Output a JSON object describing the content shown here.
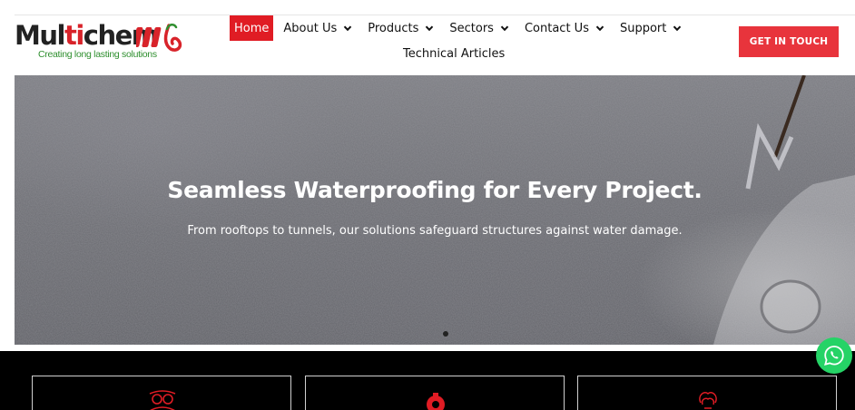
{
  "brand": {
    "name_part1": "Mul",
    "name_highlight": "ti",
    "name_part2": "chem",
    "tagline": "Creating long lasting solutions"
  },
  "nav": {
    "items": [
      {
        "label": "Home",
        "active": true,
        "dropdown": false
      },
      {
        "label": "About Us",
        "active": false,
        "dropdown": true
      },
      {
        "label": "Products",
        "active": false,
        "dropdown": true
      },
      {
        "label": "Sectors",
        "active": false,
        "dropdown": true
      },
      {
        "label": "Contact Us",
        "active": false,
        "dropdown": true
      },
      {
        "label": "Support",
        "active": false,
        "dropdown": true
      }
    ],
    "row2": "Technical Articles"
  },
  "cta": {
    "label": "GET IN TOUCH"
  },
  "hero": {
    "title": "Seamless Waterproofing for Every Project.",
    "subtitle": "From rooftops to tunnels, our solutions safeguard structures against water damage."
  },
  "features": {
    "icons": [
      "people-group-icon",
      "gear-icon",
      "lightbulb-icon"
    ]
  },
  "colors": {
    "accent": "#e01c24",
    "cta": "#e8343c",
    "band": "#000000",
    "whatsapp": "#25d366"
  }
}
